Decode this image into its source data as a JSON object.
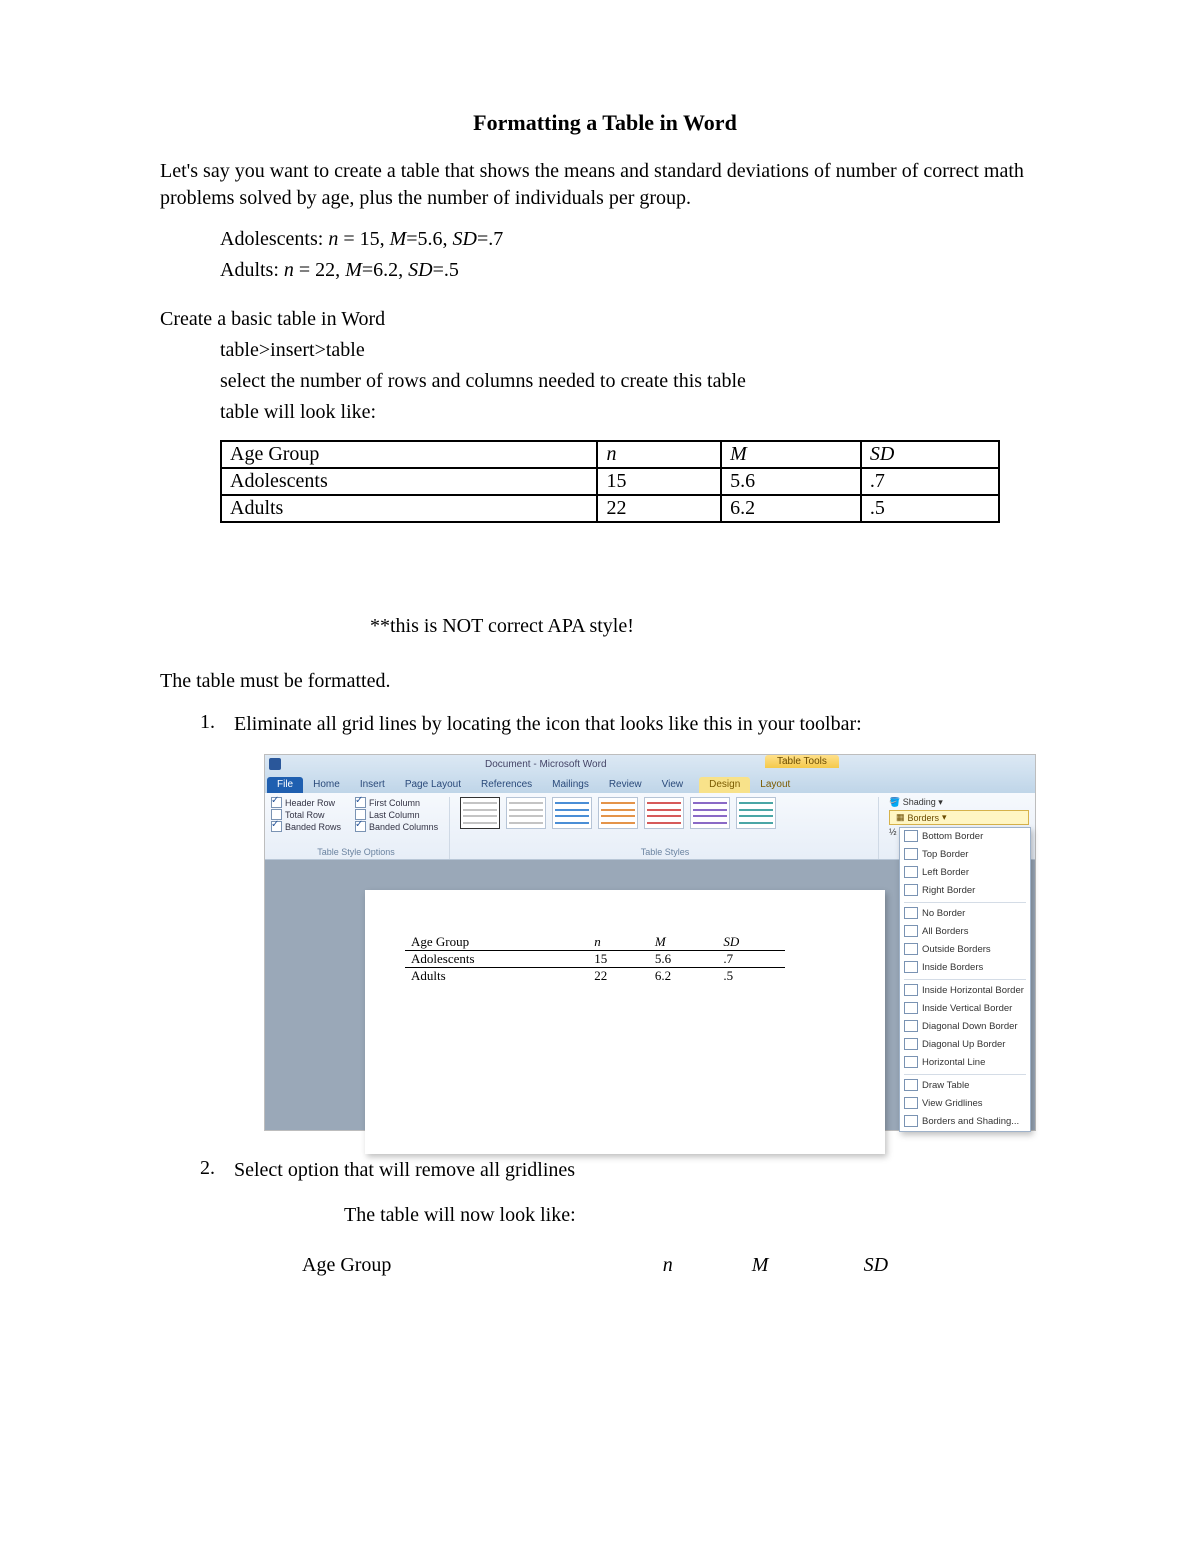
{
  "title": "Formatting a Table in Word",
  "intro": "Let's say you want to create a table that shows the means and standard deviations of number of correct math problems solved by age, plus the number of individuals per group.",
  "stats": {
    "adolescents_pre": "Adolescents: ",
    "adolescents_n_lbl": "n",
    "adolescents_n_eq": " = 15, ",
    "adolescents_m_lbl": "M",
    "adolescents_m_eq": "=5.6, ",
    "adolescents_sd_lbl": "SD",
    "adolescents_sd_eq": "=.7",
    "adults_pre": "Adults: ",
    "adults_n_lbl": "n",
    "adults_n_eq": " = 22, ",
    "adults_m_lbl": "M",
    "adults_m_eq": "=6.2, ",
    "adults_sd_lbl": "SD",
    "adults_sd_eq": "=.5"
  },
  "create_heading": "Create a basic table in Word",
  "create_steps": {
    "s1": "table>insert>table",
    "s2": "select the number of rows and columns needed to create this table",
    "s3": "table will look like:"
  },
  "table": {
    "headers": {
      "c0": "Age Group",
      "c1": "n",
      "c2": "M",
      "c3": "SD"
    },
    "rows": [
      {
        "c0": "Adolescents",
        "c1": "15",
        "c2": "5.6",
        "c3": ".7"
      },
      {
        "c0": "Adults",
        "c1": "22",
        "c2": "6.2",
        "c3": ".5"
      }
    ]
  },
  "apa_note": "**this is NOT correct APA style!",
  "must_format": "The table must be formatted.",
  "steps": {
    "num1": "1.",
    "text1": "Eliminate all grid lines by locating the icon that looks like this in your toolbar:",
    "num2": "2.",
    "text2": "Select option that will remove all gridlines",
    "sub2": "The table will now look like:"
  },
  "word": {
    "titlebar": "Document - Microsoft Word",
    "tooltab": "Table Tools",
    "tabs": {
      "file": "File",
      "home": "Home",
      "insert": "Insert",
      "pagelayout": "Page Layout",
      "references": "References",
      "mailings": "Mailings",
      "review": "Review",
      "view": "View",
      "design": "Design",
      "layout": "Layout"
    },
    "opts": {
      "headerrow": "Header Row",
      "totalrow": "Total Row",
      "bandedrows": "Banded Rows",
      "firstcol": "First Column",
      "lastcol": "Last Column",
      "bandedcols": "Banded Columns"
    },
    "groups": {
      "styleopts": "Table Style Options",
      "styles": "Table Styles"
    },
    "shading": "Shading",
    "borders": "Borders",
    "pen": "½ pt",
    "menu": {
      "bottom": "Bottom Border",
      "top": "Top Border",
      "left": "Left Border",
      "right": "Right Border",
      "none": "No Border",
      "all": "All Borders",
      "outside": "Outside Borders",
      "inside": "Inside Borders",
      "ihoriz": "Inside Horizontal Border",
      "ivert": "Inside Vertical Border",
      "ddown": "Diagonal Down Border",
      "dup": "Diagonal Up Border",
      "hline": "Horizontal Line",
      "draw": "Draw Table",
      "grid": "View Gridlines",
      "bns": "Borders and Shading..."
    },
    "mini": {
      "h0": "Age Group",
      "h1": "n",
      "h2": "M",
      "h3": "SD",
      "r1c0": "Adolescents",
      "r1c1": "15",
      "r1c2": "5.6",
      "r1c3": ".7",
      "r2c0": "Adults",
      "r2c1": "22",
      "r2c2": "6.2",
      "r2c3": ".5"
    }
  }
}
